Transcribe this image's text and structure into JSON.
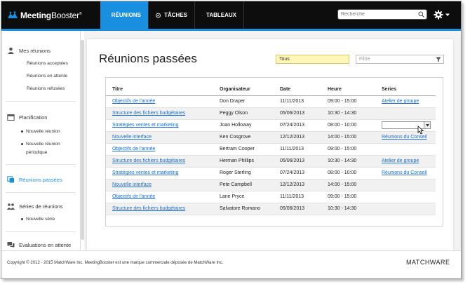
{
  "app": {
    "name_bold": "Meeting",
    "name_rest": "Booster",
    "tm": "®"
  },
  "nav": {
    "reunions": "RÉUNIONS",
    "taches": "TÂCHES",
    "tableaux": "TABLEAUX"
  },
  "search": {
    "placeholder": "Recherche"
  },
  "sidebar": {
    "mes_reunions": "Mes réunions",
    "acceptees": "Réunions acceptées",
    "en_attente": "Réunions en attente",
    "refusees": "Réunions refusées",
    "planification": "Planification",
    "nouvelle_reunion": "Nouvelle réunion",
    "nouvelle_reunion_periodique_1": "Nouvelle réunion",
    "nouvelle_reunion_periodique_2": "périodique",
    "reunions_passees": "Réunions passées",
    "series": "Séries de réunions",
    "nouvelle_serie": "Nouvelle série",
    "evaluations": "Evaluations en attente"
  },
  "main": {
    "title": "Réunions passées",
    "filter_selected": "Tous",
    "filter_placeholder": "Filtre"
  },
  "table": {
    "headers": {
      "titre": "Titre",
      "organisateur": "Organisateur",
      "date": "Date",
      "heure": "Heure",
      "series": "Series"
    },
    "rows": [
      {
        "titre": "Objectifs de l'année",
        "org": "Don Draper",
        "date": "11/11/2013",
        "heure": "09:00 - 15:00",
        "series": "Atelier de groupe"
      },
      {
        "titre": "Structure des fichiers budgétaires",
        "org": "Peggy Olson",
        "date": "05/06/2013",
        "heure": "10:30 - 14:30",
        "series": ""
      },
      {
        "titre": "Stratégies ventes et marketing",
        "org": "Joan Holloway",
        "date": "07/24/2013",
        "heure": "08:00 - 10:00",
        "series": ""
      },
      {
        "titre": "Nouvelle interface",
        "org": "Ken Cosgrove",
        "date": "12/12/2013",
        "heure": "14:00 - 15:00",
        "series": "Réunions du Conseil"
      },
      {
        "titre": "Objectifs de l'année",
        "org": "Bertram Cooper",
        "date": "11/11/2013",
        "heure": "09:00 - 15:00",
        "series": ""
      },
      {
        "titre": "Structure des fichiers budgétaires",
        "org": "Herman Phillips",
        "date": "05/06/2013",
        "heure": "10:30 - 14:30",
        "series": "Atelier de groupe"
      },
      {
        "titre": "Stratégies ventes et marketing",
        "org": "Roger Sterling",
        "date": "07/24/2013",
        "heure": "08:00 - 10:00",
        "series": "Réunions du Conseil"
      },
      {
        "titre": "Nouvelle interface",
        "org": "Pete Campbell",
        "date": "12/12/2013",
        "heure": "14:00 - 15:00",
        "series": ""
      },
      {
        "titre": "Objectifs de l'année",
        "org": "Lane Pryce",
        "date": "11/11/2013",
        "heure": "09:00 - 15:00",
        "series": ""
      },
      {
        "titre": "Structure des fichiers budgétaires",
        "org": "Salvatore Romano",
        "date": "05/06/2013",
        "heure": "10:30 - 14:30",
        "series": ""
      }
    ]
  },
  "footer": {
    "copyright": "Copyright © 2012 - 2015 MatchWare Inc. MeetingBooster est une marque commerciale déposée de MatchWare Inc.",
    "brand": "MATCHWARE"
  },
  "colors": {
    "accent": "#1a8fe0",
    "topbar": "#0d0d0d",
    "link": "#1a6fd0",
    "filter_bg": "#fff6b8"
  },
  "icons": {
    "logo": "meetingbooster-logo",
    "reunions": "people-icon",
    "taches": "check-circle-icon",
    "tableaux": "chart-icon",
    "search": "search-icon",
    "settings": "gear-icon",
    "filter": "funnel-icon"
  }
}
